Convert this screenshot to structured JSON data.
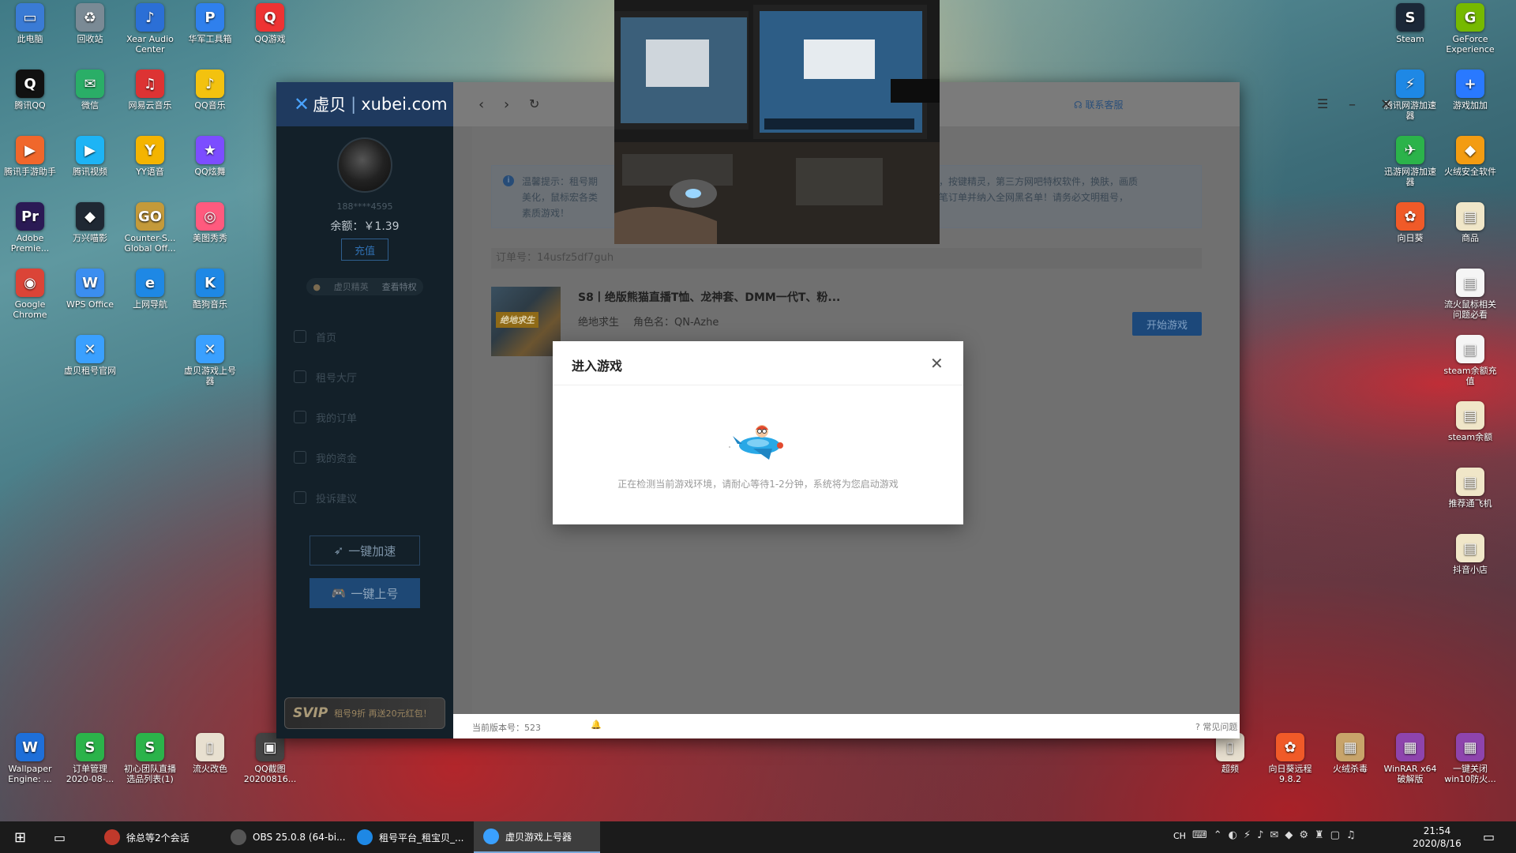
{
  "desktop": {
    "icons_left": [
      {
        "label": "此电脑",
        "color": "#3a7bd5",
        "glyph": "▭"
      },
      {
        "label": "回收站",
        "color": "#7a8a95",
        "glyph": "♻"
      },
      {
        "label": "Xear Audio Center",
        "color": "#2b6fd6",
        "glyph": "♪"
      },
      {
        "label": "华军工具箱",
        "color": "#2f80ed",
        "glyph": "P"
      },
      {
        "label": "QQ游戏",
        "color": "#e33",
        "glyph": "Q"
      },
      {
        "label": "腾讯QQ",
        "color": "#111",
        "glyph": "Q"
      },
      {
        "label": "微信",
        "color": "#2aae67",
        "glyph": "✉"
      },
      {
        "label": "网易云音乐",
        "color": "#d33",
        "glyph": "♫"
      },
      {
        "label": "QQ音乐",
        "color": "#f3c20f",
        "glyph": "♪"
      },
      {
        "label": "腾讯手游助手",
        "color": "#f0672b",
        "glyph": "▶"
      },
      {
        "label": "腾讯视频",
        "color": "#1db4f5",
        "glyph": "▶"
      },
      {
        "label": "YY语音",
        "color": "#f4b400",
        "glyph": "Y"
      },
      {
        "label": "QQ炫舞",
        "color": "#7c4dff",
        "glyph": "★"
      },
      {
        "label": "Adobe Premie...",
        "color": "#2b1a55",
        "glyph": "Pr"
      },
      {
        "label": "万兴喵影",
        "color": "#1f2833",
        "glyph": "◆"
      },
      {
        "label": "Counter-S... Global Off...",
        "color": "#c49a3a",
        "glyph": "GO"
      },
      {
        "label": "美图秀秀",
        "color": "#ff5a7e",
        "glyph": "◎"
      },
      {
        "label": "Google Chrome",
        "color": "#db4437",
        "glyph": "◉"
      },
      {
        "label": "WPS Office",
        "color": "#3b8ef0",
        "glyph": "W"
      },
      {
        "label": "上网导航",
        "color": "#1e88e5",
        "glyph": "e"
      },
      {
        "label": "酷狗音乐",
        "color": "#1e88e5",
        "glyph": "K"
      },
      {
        "label": "虚贝租号官网",
        "color": "#3aa0ff",
        "glyph": "✕"
      },
      {
        "label": "虚贝游戏上号器",
        "color": "#3aa0ff",
        "glyph": "✕"
      }
    ],
    "icons_right": [
      {
        "label": "Steam",
        "color": "#1b2838",
        "glyph": "S"
      },
      {
        "label": "GeForce Experience",
        "color": "#76b900",
        "glyph": "G"
      },
      {
        "label": "腾讯网游加速器",
        "color": "#1e88e5",
        "glyph": "⚡"
      },
      {
        "label": "游戏加加",
        "color": "#2979ff",
        "glyph": "+"
      },
      {
        "label": "迅游网游加速器",
        "color": "#2bb34a",
        "glyph": "✈"
      },
      {
        "label": "火绒安全软件",
        "color": "#f39c12",
        "glyph": "◆"
      },
      {
        "label": "向日葵",
        "color": "#f05a28",
        "glyph": "✿"
      },
      {
        "label": "商品",
        "color": "#f0e6c8",
        "glyph": "▤"
      },
      {
        "label": "流火鼠标相关问题必看",
        "color": "#f5f5f5",
        "glyph": "▤"
      },
      {
        "label": "steam余额充值",
        "color": "#f5f5f5",
        "glyph": "▤"
      },
      {
        "label": "steam余额",
        "color": "#f0e6c8",
        "glyph": "▤"
      },
      {
        "label": "推荐通飞机",
        "color": "#f0e6c8",
        "glyph": "▤"
      },
      {
        "label": "抖音小店",
        "color": "#f0e6c8",
        "glyph": "▤"
      }
    ],
    "icons_bottom": [
      {
        "label": "Wallpaper Engine: ...",
        "color": "#1e6fd9",
        "glyph": "W"
      },
      {
        "label": "订单管理 2020-08-...",
        "color": "#2bb34a",
        "glyph": "S"
      },
      {
        "label": "初心团队直播选品列表(1)",
        "color": "#2bb34a",
        "glyph": "S"
      },
      {
        "label": "流火改色",
        "color": "#e8e0d0",
        "glyph": "▯"
      },
      {
        "label": "QQ截图 20200816...",
        "color": "#444",
        "glyph": "▣"
      },
      {
        "label": "超频",
        "color": "#e8e0d0",
        "glyph": "▯"
      },
      {
        "label": "向日葵远程 9.8.2",
        "color": "#f05a28",
        "glyph": "✿"
      },
      {
        "label": "火绒杀毒",
        "color": "#c8a46a",
        "glyph": "▦"
      },
      {
        "label": "WinRAR x64 破解版",
        "color": "#8e44ad",
        "glyph": "▦"
      },
      {
        "label": "一键关闭 win10防火...",
        "color": "#8e44ad",
        "glyph": "▦"
      }
    ]
  },
  "app": {
    "brand": "虚贝",
    "domain": "xubei.com",
    "contact_label": "联系客服",
    "user": {
      "phone": "188****4595",
      "balance": "余额：￥1.39",
      "recharge": "充值"
    },
    "vip": {
      "label": "虚贝精英",
      "link": "查看特权"
    },
    "nav": [
      "首页",
      "租号大厅",
      "我的订单",
      "我的资金",
      "投诉建议"
    ],
    "buttons": {
      "accelerate": "一键加速",
      "login": "一键上号"
    },
    "svip": {
      "badge": "SVIP",
      "text": "租号9折 再送20元红包！"
    },
    "notice": {
      "line1_left": "温馨提示：租号期",
      "line1_right": "挂，按键精灵，第三方网吧特权软件，换肤，画质",
      "line2_left": "美化，鼠标宏各类",
      "line2_right": "该笔订单并纳入全网黑名单！请务必文明租号，",
      "line3": "素质游戏！"
    },
    "order": {
      "number": "订单号：14usfz5df7guh",
      "thumb_tag": "绝地求生",
      "title": "S8丨绝版熊猫直播T恤、龙神套、DMM一代T、粉...",
      "game": "绝地求生",
      "role": "角色名：QN-Azhe",
      "start": "开始游戏"
    },
    "status": {
      "version": "当前版本号：523",
      "faq": "常见问题"
    }
  },
  "modal": {
    "title": "进入游戏",
    "message": "正在检测当前游戏环境，请耐心等待1-2分钟，系统将为您启动游戏"
  },
  "taskbar": {
    "items": [
      {
        "label": "徐总等2个会话",
        "color": "#c0392b"
      },
      {
        "label": "OBS 25.0.8 (64-bi...",
        "color": "#555"
      },
      {
        "label": "租号平台_租宝贝_...",
        "color": "#1e88e5"
      },
      {
        "label": "虚贝游戏上号器",
        "color": "#3aa0ff"
      }
    ],
    "time": "21:54",
    "date": "2020/8/16",
    "lang": "CH"
  },
  "colors": {
    "accent": "#1e88e5",
    "sidebar": "#132029",
    "logo_bar": "#1f3a5f"
  }
}
